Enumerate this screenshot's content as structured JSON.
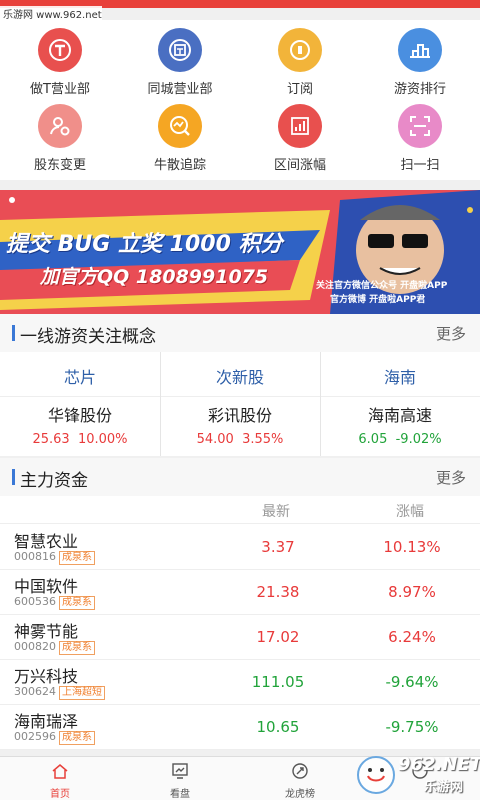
{
  "watermark": {
    "top_text": "乐游网 www.962.net",
    "corner_text": "962.NET",
    "corner_sub": "乐游网"
  },
  "grid": [
    {
      "label": "做T营业部",
      "icon": "t-circle-icon",
      "color": "#e8504e"
    },
    {
      "label": "同城营业部",
      "icon": "same-city-icon",
      "color": "#4a6fc2"
    },
    {
      "label": "订阅",
      "icon": "subscribe-icon",
      "color": "#f2b43a"
    },
    {
      "label": "游资排行",
      "icon": "ranking-icon",
      "color": "#4a8fe0"
    },
    {
      "label": "股东变更",
      "icon": "shareholder-icon",
      "color": "#f08f8a"
    },
    {
      "label": "牛散追踪",
      "icon": "tracking-icon",
      "color": "#f5a623"
    },
    {
      "label": "区间涨幅",
      "icon": "bar-chart-icon",
      "color": "#e8504e"
    },
    {
      "label": "扫一扫",
      "icon": "scan-icon",
      "color": "#e88ac8"
    }
  ],
  "banner": {
    "line1": "提交 BUG 立奖 1000 积分",
    "line2": "加官方QQ 1808991075",
    "note1": "关注官方微信公众号 开盘啦APP",
    "note2": "官方微博 开盘啦APP君"
  },
  "concept_section": {
    "title": "一线游资关注概念",
    "more": "更多"
  },
  "concepts": [
    {
      "name": "芯片",
      "stock": "华锋股份",
      "price": "25.63",
      "change": "10.00%",
      "dir": "up"
    },
    {
      "name": "次新股",
      "stock": "彩讯股份",
      "price": "54.00",
      "change": "3.55%",
      "dir": "up"
    },
    {
      "name": "海南",
      "stock": "海南高速",
      "price": "6.05",
      "change": "-9.02%",
      "dir": "down"
    }
  ],
  "capital_section": {
    "title": "主力资金",
    "more": "更多",
    "col_latest": "最新",
    "col_change": "涨幅"
  },
  "rows": [
    {
      "name": "智慧农业",
      "code": "000816",
      "tag": "成泉系",
      "price": "3.37",
      "change": "10.13%",
      "dir": "up"
    },
    {
      "name": "中国软件",
      "code": "600536",
      "tag": "成泉系",
      "price": "21.38",
      "change": "8.97%",
      "dir": "up"
    },
    {
      "name": "神雾节能",
      "code": "000820",
      "tag": "成泉系",
      "price": "17.02",
      "change": "6.24%",
      "dir": "up"
    },
    {
      "name": "万兴科技",
      "code": "300624",
      "tag": "上海超短",
      "price": "111.05",
      "change": "-9.64%",
      "dir": "down"
    },
    {
      "name": "海南瑞泽",
      "code": "002596",
      "tag": "成泉系",
      "price": "10.65",
      "change": "-9.75%",
      "dir": "down"
    }
  ],
  "tabs": [
    {
      "label": "首页",
      "icon": "home-icon",
      "active": true
    },
    {
      "label": "看盘",
      "icon": "monitor-icon",
      "active": false
    },
    {
      "label": "龙虎榜",
      "icon": "dragon-tiger-icon",
      "active": false
    },
    {
      "label": "",
      "icon": "more-icon",
      "active": false
    }
  ],
  "colors": {
    "up": "#e83a3a",
    "down": "#21a33a",
    "active_tab": "#e8403a",
    "inactive_tab": "#666666"
  }
}
